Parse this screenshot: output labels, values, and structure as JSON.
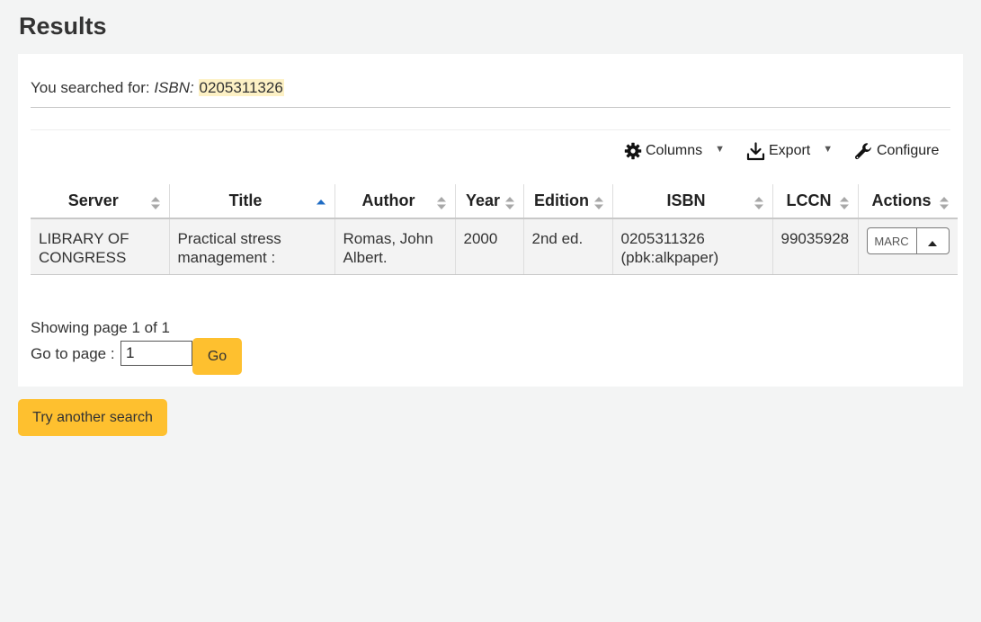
{
  "page": {
    "title": "Results"
  },
  "search": {
    "prefix": "You searched for: ",
    "field_label": "ISBN:",
    "term": "0205311326"
  },
  "toolbar": {
    "columns_label": "Columns",
    "export_label": "Export",
    "configure_label": "Configure"
  },
  "table": {
    "headers": {
      "server": "Server",
      "title": "Title",
      "author": "Author",
      "year": "Year",
      "edition": "Edition",
      "isbn": "ISBN",
      "lccn": "LCCN",
      "actions": "Actions"
    },
    "sorted_column": "title",
    "sort_direction": "ascending",
    "rows": [
      {
        "server": "LIBRARY OF CONGRESS",
        "title": "Practical stress management :",
        "author": "Romas, John Albert.",
        "year": "2000",
        "edition": "2nd ed.",
        "isbn": "0205311326 (pbk:alkpaper)",
        "lccn": "99035928",
        "action_button": "MARC"
      }
    ]
  },
  "paging": {
    "status": "Showing page 1 of 1",
    "goto_label": "Go to page :",
    "goto_value": "1",
    "go_label": "Go"
  },
  "footer": {
    "try_another_label": "Try another search"
  },
  "colors": {
    "accent_button": "#fec02f",
    "highlight": "#fdf1c5",
    "sort_active": "#1f6cc4",
    "sort_inactive": "#a8a8a8",
    "page_bg": "#f3f4f4"
  }
}
